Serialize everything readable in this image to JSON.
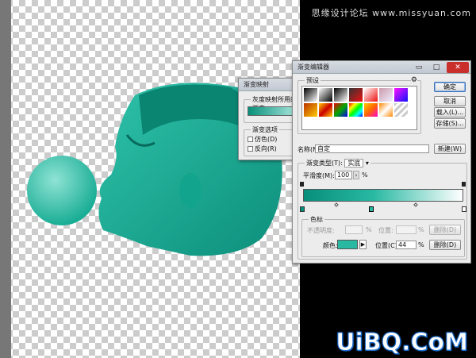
{
  "watermark_top": "思缘设计论坛 www.missyuan.com",
  "watermark_bottom": "UiBQ.CoM",
  "colors": {
    "teal": "#19b59a",
    "teal_dark": "#078f7a",
    "teal_light": "#ffffff",
    "bubble": "#3fc9b3"
  },
  "gradient_map": {
    "title": "渐变映射",
    "gradient_group": "灰度映射所用的渐变",
    "options_group": "渐变选项",
    "dither": "仿色(D)",
    "reverse": "反向(R)"
  },
  "gradient_editor": {
    "title": "渐变编辑器",
    "controls": {
      "minimize": "▭",
      "maximize": "□",
      "close": "✕"
    },
    "presets_label": "预设",
    "presets_menu_icon": "gear-icon",
    "buttons": {
      "ok": "确定",
      "cancel": "取消",
      "load": "载入(L)...",
      "save": "存储(S)...",
      "new": "新建(W)"
    },
    "name_label": "名称(N):",
    "name_value": "自定",
    "type_group_label": "渐变类型(T):",
    "type_value": "实底",
    "smoothness_label": "平滑度(M):",
    "smoothness_value": "100",
    "smoothness_unit": "%",
    "stops_group": "色标",
    "opacity_label": "不透明度:",
    "opacity_unit": "%",
    "location_label": "位置:",
    "location_label2": "位置(C):",
    "location_value": "44",
    "location_unit": "%",
    "delete_label": "删除(D)",
    "color_label": "颜色:",
    "stop_color": "#29b9a3",
    "gradient_start": "#078f7a",
    "gradient_end": "#ffffff"
  }
}
